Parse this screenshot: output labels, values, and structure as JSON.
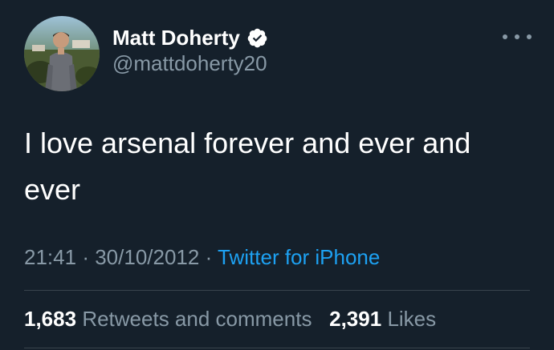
{
  "user": {
    "display_name": "Matt Doherty",
    "handle": "@mattdoherty20",
    "avatar_icon": "profile-photo",
    "verified_icon": "verified-badge-icon"
  },
  "tweet": {
    "text": "I love arsenal forever and ever and ever"
  },
  "meta": {
    "time": "21:41",
    "separator": "·",
    "date": "30/10/2012",
    "source": "Twitter for iPhone"
  },
  "stats": {
    "retweets_count": "1,683",
    "retweets_label": "Retweets and comments",
    "likes_count": "2,391",
    "likes_label": "Likes"
  },
  "colors": {
    "background": "#15202b",
    "secondary_text": "#8899a6",
    "link": "#1da1f2",
    "divider": "#38444d"
  }
}
